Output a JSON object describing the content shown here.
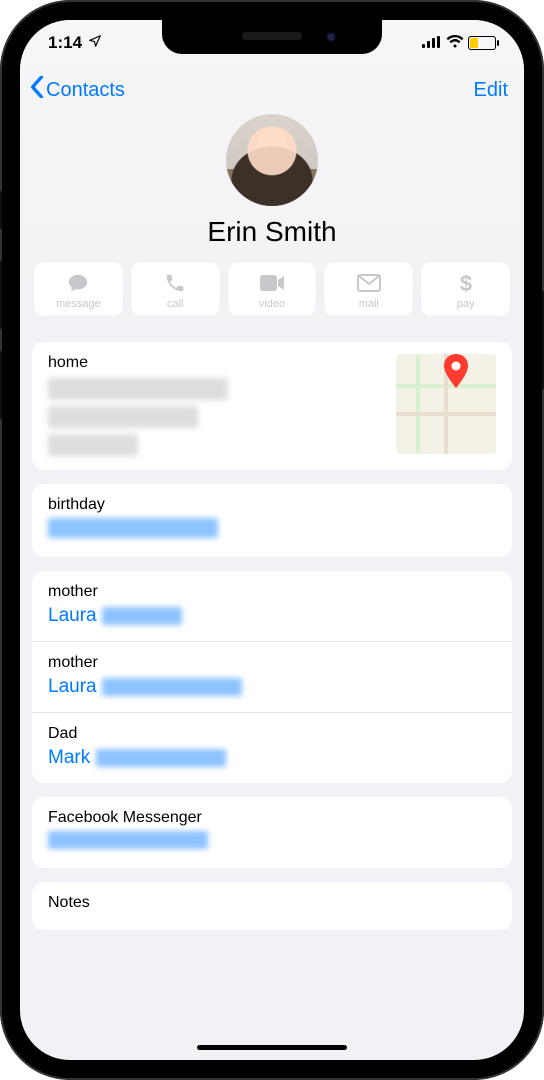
{
  "status": {
    "time": "1:14",
    "low_power": true
  },
  "nav": {
    "back_label": "Contacts",
    "edit_label": "Edit"
  },
  "contact": {
    "name": "Erin Smith"
  },
  "actions": [
    {
      "id": "message",
      "label": "message"
    },
    {
      "id": "call",
      "label": "call"
    },
    {
      "id": "video",
      "label": "video"
    },
    {
      "id": "mail",
      "label": "mail"
    },
    {
      "id": "pay",
      "label": "pay"
    }
  ],
  "address": {
    "label": "home"
  },
  "birthday": {
    "label": "birthday"
  },
  "relations": [
    {
      "label": "mother",
      "name": "Laura"
    },
    {
      "label": "mother",
      "name": "Laura"
    },
    {
      "label": "Dad",
      "name": "Mark"
    }
  ],
  "social": {
    "label": "Facebook Messenger"
  },
  "notes": {
    "label": "Notes"
  }
}
